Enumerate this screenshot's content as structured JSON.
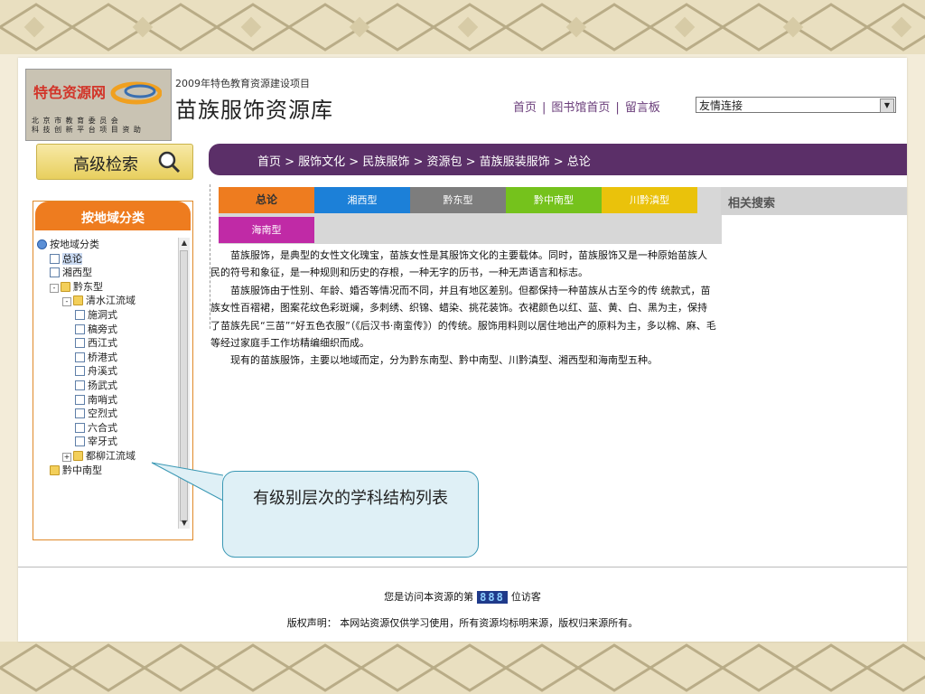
{
  "header": {
    "logo_brand": "特色资源网",
    "logo_sub_line1": "北 京 市 教 育 委 员 会",
    "logo_sub_line2": "科 技 创 新 平 台 项 目 资 助",
    "project_line": "2009年特色教育资源建设项目",
    "site_title": "苗族服饰资源库",
    "nav": [
      "首页",
      "图书馆首页",
      "留言板"
    ],
    "friend_links_value": "友情连接"
  },
  "advanced_search": {
    "label": "高级检索"
  },
  "breadcrumb": "首页 > 服饰文化 > 民族服饰 > 资源包 > 苗族服装服饰 > 总论",
  "left_panel": {
    "title": "按地域分类",
    "tree": [
      {
        "label": "按地域分类",
        "level": 0,
        "type": "root"
      },
      {
        "label": "总论",
        "level": 1,
        "type": "page",
        "selected": true
      },
      {
        "label": "湘西型",
        "level": 1,
        "type": "page"
      },
      {
        "label": "黔东型",
        "level": 1,
        "type": "folder",
        "expander": "-"
      },
      {
        "label": "清水江流域",
        "level": 2,
        "type": "folder",
        "expander": "-"
      },
      {
        "label": "施洞式",
        "level": 3,
        "type": "page"
      },
      {
        "label": "稿旁式",
        "level": 3,
        "type": "page"
      },
      {
        "label": "西江式",
        "level": 3,
        "type": "page"
      },
      {
        "label": "桥港式",
        "level": 3,
        "type": "page"
      },
      {
        "label": "舟溪式",
        "level": 3,
        "type": "page"
      },
      {
        "label": "扬武式",
        "level": 3,
        "type": "page"
      },
      {
        "label": "南哨式",
        "level": 3,
        "type": "page"
      },
      {
        "label": "空烈式",
        "level": 3,
        "type": "page"
      },
      {
        "label": "六合式",
        "level": 3,
        "type": "page"
      },
      {
        "label": "宰牙式",
        "level": 3,
        "type": "page"
      },
      {
        "label": "都柳江流域",
        "level": 2,
        "type": "folder",
        "expander": "+"
      },
      {
        "label": "黔中南型",
        "level": 1,
        "type": "folder"
      }
    ]
  },
  "tabs": [
    {
      "label": "总论",
      "color": "#ee7c1f",
      "active": true
    },
    {
      "label": "湘西型",
      "color": "#1c80d8"
    },
    {
      "label": "黔东型",
      "color": "#7d7d7d"
    },
    {
      "label": "黔中南型",
      "color": "#75c21c"
    },
    {
      "label": "川黔滇型",
      "color": "#eac20b"
    },
    {
      "label": "海南型",
      "color": "#c02aa6"
    }
  ],
  "related_search": "相关搜索",
  "article": [
    "苗族服饰，是典型的女性文化瑰宝，苗族女性是其服饰文化的主要载体。同时，苗族服饰又是一种原始苗族人民的符号和象征，是一种规则和历史的存根，一种无字的历书，一种无声语言和标志。",
    "苗族服饰由于性别、年龄、婚否等情况而不同，并且有地区差别。但都保持一种苗族从古至今的传 统款式，苗族女性百褶裙，图案花纹色彩斑斓，多刺绣、织锦、蜡染、挑花装饰。衣裙颜色以红、蓝、黄、白、黑为主，保持了苗族先民“三苗”“好五色衣服”（《后汉书·南蛮传》）的传统。服饰用料则以居住地出产的原料为主，多以棉、麻、毛等经过家庭手工作坊精编细织而成。",
    "现有的苗族服饰，主要以地域而定，分为黔东南型、黔中南型、川黔滇型、湘西型和海南型五种。"
  ],
  "callout": "有级别层次的学科结构列表",
  "footer": {
    "counter_prefix": "您是访问本资源的第",
    "counter_value": "888",
    "counter_suffix": "位访客",
    "copyright": "版权声明： 本网站资源仅供学习使用，所有资源均标明来源，版权归来源所有。"
  }
}
